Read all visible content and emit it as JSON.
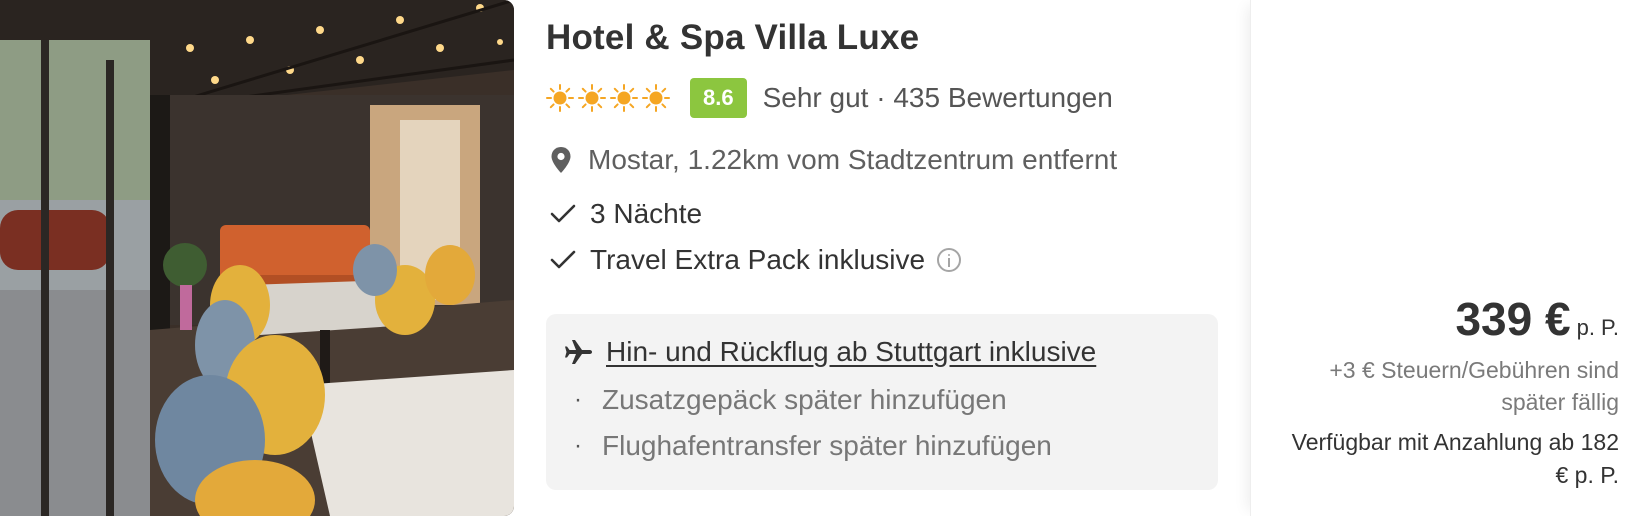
{
  "hotel": {
    "name": "Hotel & Spa Villa Luxe",
    "sun_rating": 4,
    "score": "8.6",
    "rating_text": "Sehr gut · 435 Bewertungen",
    "location": "Mostar, 1.22km vom Stadtzentrum entfernt"
  },
  "features": [
    {
      "label": "3 Nächte",
      "info": false
    },
    {
      "label": "Travel Extra Pack inklusive",
      "info": true
    }
  ],
  "flight": {
    "link_label": "Hin- und Rückflug ab Stuttgart inklusive",
    "extras": [
      "Zusatzgepäck später hinzufügen",
      "Flughafentransfer später hinzufügen"
    ]
  },
  "price": {
    "amount": "339 €",
    "unit": "p. P.",
    "fees": "+3 € Steuern/Gebühren sind später fällig",
    "deposit": "Verfügbar mit Anzahlung ab 182 € p. P."
  },
  "colors": {
    "score_bg": "#8cc63f",
    "sun": "#f5a623",
    "text": "#333333",
    "muted": "#777777",
    "flight_box_bg": "#f3f3f3"
  },
  "icons": {
    "sun": "sun-icon",
    "location": "location-pin-icon",
    "check": "check-icon",
    "info": "info-icon",
    "plane": "plane-icon",
    "bullet": "bullet-dot"
  }
}
